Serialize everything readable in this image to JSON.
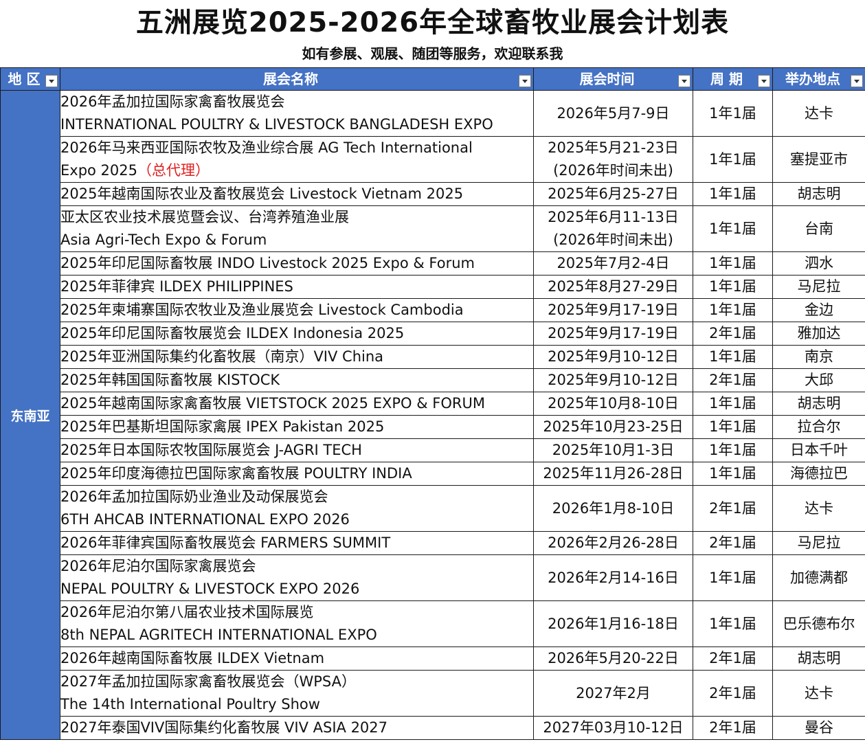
{
  "title": "五洲展览2025-2026年全球畜牧业展会计划表",
  "subtitle": "如有参展、观展、随团等服务，欢迎联系我",
  "columns": [
    "地 区",
    "展会名称",
    "展会时间",
    "周 期",
    "举办地点"
  ],
  "region": "东南亚",
  "colors": {
    "header_bg": "#4472c4",
    "header_text": "#ffffff",
    "agent": "#e02020"
  },
  "rows": [
    {
      "name": [
        "2026年孟加拉国际家禽畜牧展览会",
        "INTERNATIONAL POULTRY & LIVESTOCK BANGLADESH EXPO"
      ],
      "date": [
        "2026年5月7-9日"
      ],
      "cycle": "1年1届",
      "city": "达卡"
    },
    {
      "name": [
        "2026年马来西亚国际农牧及渔业综合展 AG Tech International",
        "Expo 2025"
      ],
      "agent": "（总代理）",
      "date": [
        "2025年5月21-23日",
        "(2026年时间未出)"
      ],
      "cycle": "1年1届",
      "city": "塞提亚市"
    },
    {
      "name": [
        "2025年越南国际农业及畜牧展览会 Livestock Vietnam 2025"
      ],
      "date": [
        "2025年6月25-27日"
      ],
      "cycle": "1年1届",
      "city": "胡志明"
    },
    {
      "name": [
        "亚太区农业技术展览暨会议、台湾养殖渔业展",
        "Asia Agri-Tech Expo & Forum"
      ],
      "date": [
        "2025年6月11-13日",
        "(2026年时间未出)"
      ],
      "cycle": "1年1届",
      "city": "台南"
    },
    {
      "name": [
        "2025年印尼国际畜牧展  INDO Livestock 2025 Expo & Forum"
      ],
      "date": [
        "2025年7月2-4日"
      ],
      "cycle": "1年1届",
      "city": "泗水"
    },
    {
      "name": [
        "2025年菲律宾 ILDEX PHILIPPINES"
      ],
      "date": [
        "2025年8月27-29日"
      ],
      "cycle": "1年1届",
      "city": "马尼拉"
    },
    {
      "name": [
        "2025年柬埔寨国际农牧业及渔业展览会 Livestock Cambodia"
      ],
      "date": [
        "2025年9月17-19日"
      ],
      "cycle": "1年1届",
      "city": "金边"
    },
    {
      "name": [
        "2025年印尼国际畜牧展览会 ILDEX Indonesia 2025"
      ],
      "date": [
        "2025年9月17-19日"
      ],
      "cycle": "2年1届",
      "city": "雅加达"
    },
    {
      "name": [
        "2025年亚洲国际集约化畜牧展（南京）VIV China"
      ],
      "date": [
        "2025年9月10-12日"
      ],
      "cycle": "1年1届",
      "city": "南京"
    },
    {
      "name": [
        "2025年韩国国际畜牧展 KISTOCK"
      ],
      "date": [
        "2025年9月10-12日"
      ],
      "cycle": "2年1届",
      "city": "大邱"
    },
    {
      "name": [
        "2025年越南国际家禽畜牧展  VIETSTOCK 2025 EXPO & FORUM"
      ],
      "date": [
        "2025年10月8-10日"
      ],
      "cycle": "1年1届",
      "city": "胡志明"
    },
    {
      "name": [
        "2025年巴基斯坦国际家禽展 IPEX Pakistan 2025"
      ],
      "date": [
        "2025年10月23-25日"
      ],
      "cycle": "1年1届",
      "city": "拉合尔"
    },
    {
      "name": [
        "2025年日本国际农牧国际展览会 J-AGRI TECH"
      ],
      "date": [
        "2025年10月1-3日"
      ],
      "cycle": "1年1届",
      "city": "日本千叶"
    },
    {
      "name": [
        "2025年印度海德拉巴国际家禽畜牧展 POULTRY INDIA"
      ],
      "date": [
        "2025年11月26-28日"
      ],
      "cycle": "1年1届",
      "city": "海德拉巴"
    },
    {
      "name": [
        "2026年孟加拉国际奶业渔业及动保展览会",
        "6TH AHCAB INTERNATIONAL EXPO 2026"
      ],
      "date": [
        "2026年1月8-10日"
      ],
      "cycle": "2年1届",
      "city": "达卡"
    },
    {
      "name": [
        "2026年菲律宾国际畜牧展览会  FARMERS SUMMIT"
      ],
      "date": [
        "2026年2月26-28日"
      ],
      "cycle": "2年1届",
      "city": "马尼拉"
    },
    {
      "name": [
        "2026年尼泊尔国际家禽展览会",
        "NEPAL POULTRY & LIVESTOCK EXPO 2026"
      ],
      "date": [
        "2026年2月14-16日"
      ],
      "cycle": "1年1届",
      "city": "加德满都"
    },
    {
      "name": [
        "2026年尼泊尔第八届农业技术国际展览",
        "8th NEPAL AGRITECH INTERNATIONAL EXPO"
      ],
      "date": [
        "2026年1月16-18日"
      ],
      "cycle": "1年1届",
      "city": "巴乐德布尔"
    },
    {
      "name": [
        "2026年越南国际畜牧展 ILDEX Vietnam"
      ],
      "date": [
        "2026年5月20-22日"
      ],
      "cycle": "2年1届",
      "city": "胡志明"
    },
    {
      "name": [
        "2027年孟加拉国际家禽畜牧展览会（WPSA）",
        "The 14th International Poultry Show"
      ],
      "date": [
        "2027年2月"
      ],
      "cycle": "2年1届",
      "city": "达卡"
    },
    {
      "name": [
        "2027年泰国VIV国际集约化畜牧展  VIV ASIA 2027"
      ],
      "date": [
        "2027年03月10-12日"
      ],
      "cycle": "2年1届",
      "city": "曼谷"
    }
  ]
}
